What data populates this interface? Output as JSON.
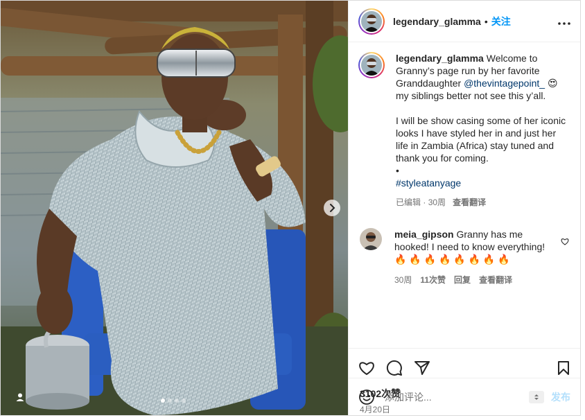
{
  "post": {
    "username": "legendary_glamma",
    "separator": "•",
    "follow_label": "关注",
    "more_label": "•••"
  },
  "caption": {
    "username": "legendary_glamma",
    "text_before_mention": "Welcome to Granny’s page run by her favorite Granddaughter",
    "mention": "@thevintagepoint_",
    "emoji": "😍",
    "text_after_mention": "my siblings better not see this y’all.",
    "paragraph2": "I will be show casing some of her iconic looks I have styled her in and just her life in Zambia (Africa) stay tuned and thank you for coming.",
    "bullet": "•",
    "hashtag": "#styleatanyage",
    "edited_label": "已编辑",
    "dot": "·",
    "time": "30周",
    "translate_label": "查看翻译"
  },
  "comments": [
    {
      "username": "meia_gipson",
      "text": "Granny has me hooked! I need to know everything!",
      "emojis": "🔥 🔥 🔥 🔥 🔥 🔥 🔥 🔥",
      "time": "30周",
      "likes": "11次赞",
      "reply_label": "回复",
      "translate_label": "查看翻译"
    }
  ],
  "actions": {
    "like_icon": "heart-icon",
    "comment_icon": "comment-icon",
    "share_icon": "paper-plane-icon",
    "save_icon": "bookmark-icon"
  },
  "likes_count": "3102次赞",
  "date": "4月20日",
  "comment_input": {
    "placeholder": "添加评论...",
    "post_label": "发布"
  },
  "carousel": {
    "total": 4,
    "active": 0
  },
  "colors": {
    "accent": "#0095f6",
    "post_disabled": "#b2dffc",
    "link": "#00376b",
    "muted": "#737373"
  }
}
